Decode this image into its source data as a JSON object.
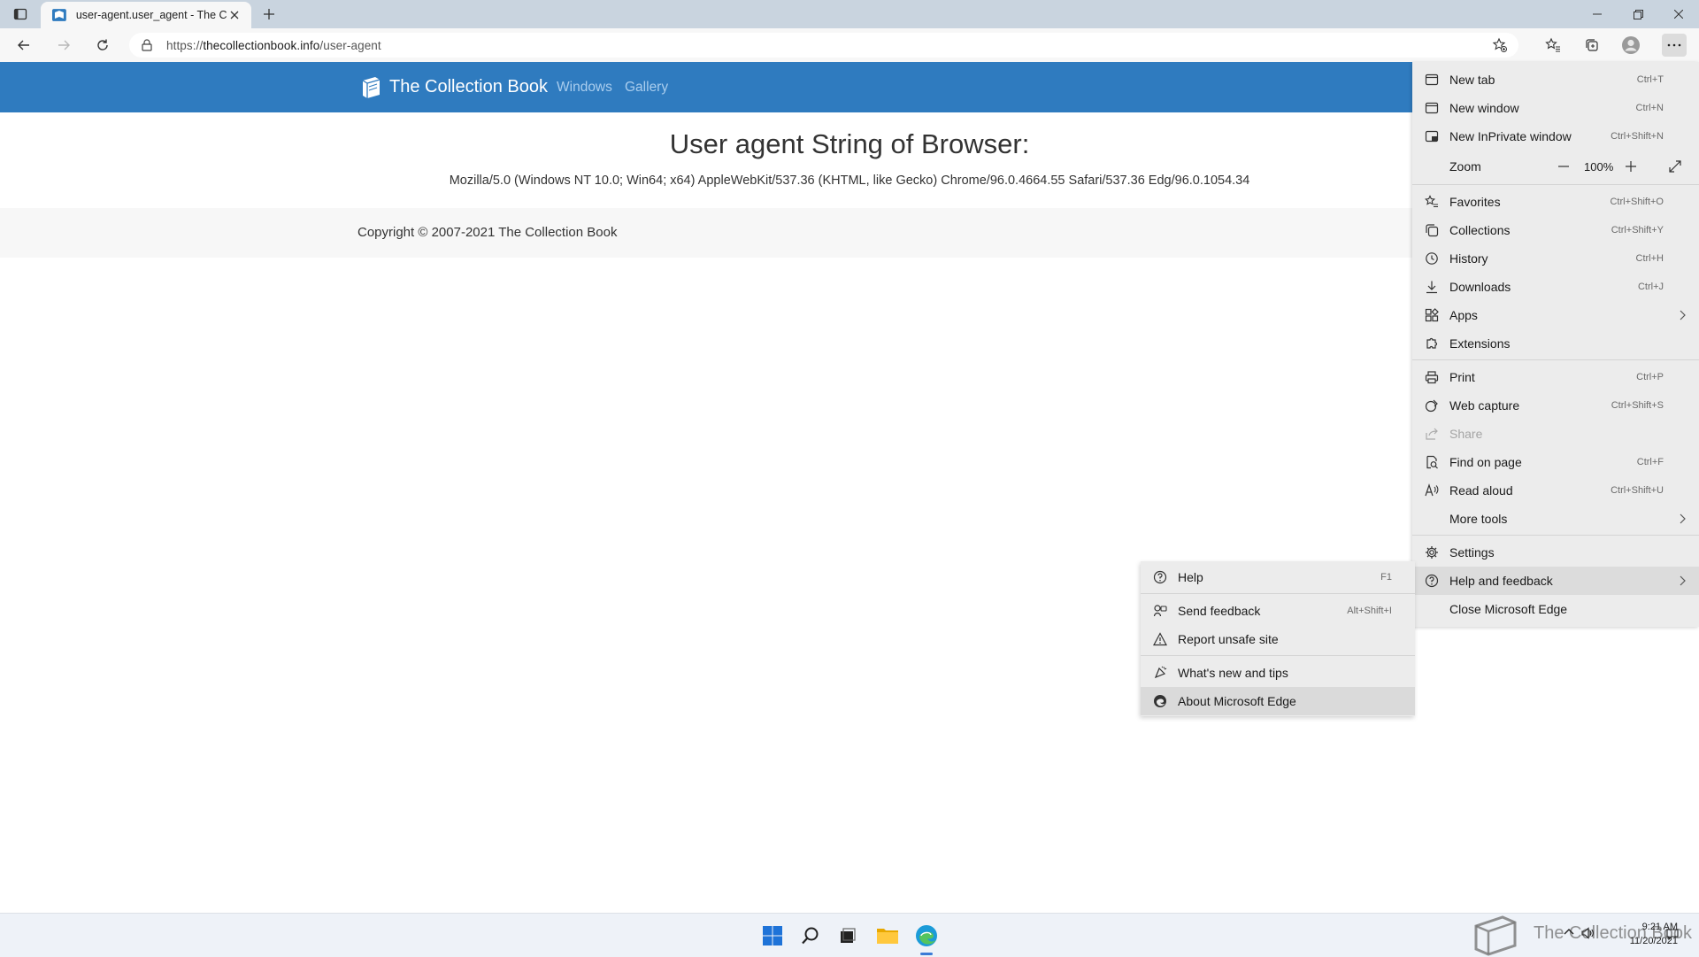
{
  "browser": {
    "tab": {
      "title": "user-agent.user_agent - The Colle",
      "close_icon": "close-icon"
    },
    "address_bar": {
      "url_prefix": "https://",
      "url_host": "thecollectionbook.info",
      "url_path": "/user-agent"
    }
  },
  "site": {
    "brand": "The Collection Book",
    "nav": [
      "Windows",
      "Gallery"
    ],
    "heading": "User agent String of Browser:",
    "user_agent": "Mozilla/5.0 (Windows NT 10.0; Win64; x64) AppleWebKit/537.36 (KHTML, like Gecko) Chrome/96.0.4664.55 Safari/537.36 Edg/96.0.1054.34",
    "footer": "Copyright © 2007-2021 The Collection Book",
    "colors": {
      "nav_bar": "#2f7bbf",
      "nav_link": "#a9cdee"
    }
  },
  "menu": {
    "items": [
      {
        "label": "New tab",
        "shortcut": "Ctrl+T",
        "icon": "new-tab-icon"
      },
      {
        "label": "New window",
        "shortcut": "Ctrl+N",
        "icon": "new-window-icon"
      },
      {
        "label": "New InPrivate window",
        "shortcut": "Ctrl+Shift+N",
        "icon": "inprivate-icon"
      },
      {
        "label": "Zoom",
        "value": "100%"
      },
      {
        "label": "Favorites",
        "shortcut": "Ctrl+Shift+O",
        "icon": "favorites-icon"
      },
      {
        "label": "Collections",
        "shortcut": "Ctrl+Shift+Y",
        "icon": "collections-icon"
      },
      {
        "label": "History",
        "shortcut": "Ctrl+H",
        "icon": "history-icon"
      },
      {
        "label": "Downloads",
        "shortcut": "Ctrl+J",
        "icon": "download-icon"
      },
      {
        "label": "Apps",
        "icon": "apps-icon",
        "submenu": true
      },
      {
        "label": "Extensions",
        "icon": "extensions-icon"
      },
      {
        "label": "Print",
        "shortcut": "Ctrl+P",
        "icon": "print-icon"
      },
      {
        "label": "Web capture",
        "shortcut": "Ctrl+Shift+S",
        "icon": "web-capture-icon"
      },
      {
        "label": "Share",
        "icon": "share-icon",
        "disabled": true
      },
      {
        "label": "Find on page",
        "shortcut": "Ctrl+F",
        "icon": "find-icon"
      },
      {
        "label": "Read aloud",
        "shortcut": "Ctrl+Shift+U",
        "icon": "read-aloud-icon"
      },
      {
        "label": "More tools",
        "submenu": true
      },
      {
        "label": "Settings",
        "icon": "settings-icon"
      },
      {
        "label": "Help and feedback",
        "icon": "help-icon",
        "submenu": true,
        "highlighted": true
      },
      {
        "label": "Close Microsoft Edge"
      }
    ]
  },
  "submenu": {
    "items": [
      {
        "label": "Help",
        "shortcut": "F1",
        "icon": "help-icon"
      },
      {
        "label": "Send feedback",
        "shortcut": "Alt+Shift+I",
        "icon": "feedback-icon"
      },
      {
        "label": "Report unsafe site",
        "icon": "warning-icon"
      },
      {
        "label": "What's new and tips",
        "icon": "tips-icon"
      },
      {
        "label": "About Microsoft Edge",
        "icon": "edge-icon",
        "highlighted": true
      }
    ]
  },
  "taskbar": {
    "watermark": "The Collection Book",
    "time": "9:21 AM",
    "date": "11/20/2021"
  }
}
